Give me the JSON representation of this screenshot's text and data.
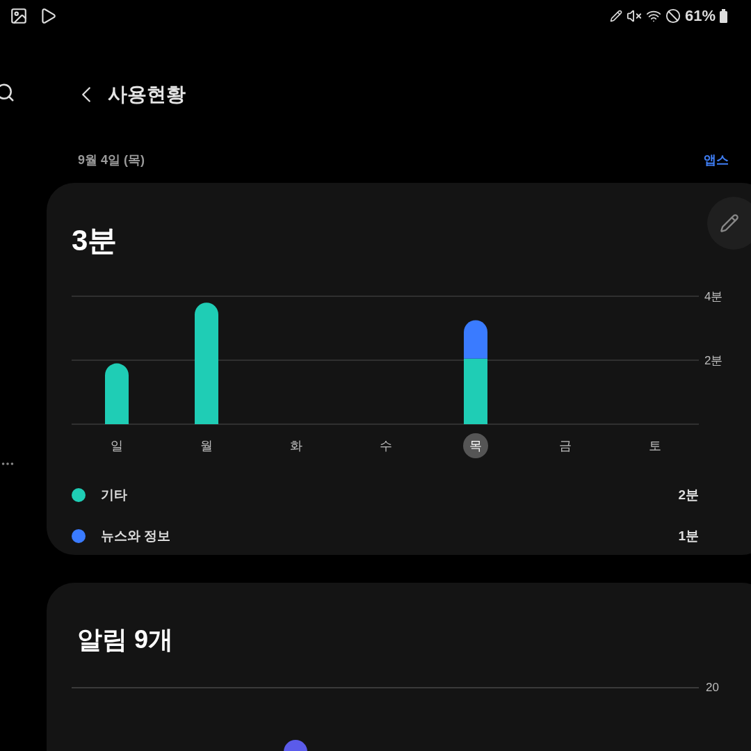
{
  "status_bar": {
    "battery": "61%"
  },
  "header": {
    "title": "사용현황",
    "date": "9월 4일 (목)",
    "link": "앱스"
  },
  "usage_card": {
    "total": "3분",
    "chart_data": {
      "type": "bar",
      "stacked": true,
      "categories": [
        "일",
        "월",
        "화",
        "수",
        "목",
        "금",
        "토"
      ],
      "series": [
        {
          "name": "기타",
          "color": "#1fcdb5",
          "values": [
            1.9,
            3.8,
            null,
            null,
            2.05,
            null,
            null
          ]
        },
        {
          "name": "뉴스와 정보",
          "color": "#3a7bff",
          "values": [
            null,
            null,
            null,
            null,
            1.2,
            null,
            null
          ]
        }
      ],
      "ylim": [
        0,
        4
      ],
      "yticks": [
        {
          "value": 2,
          "label": "2분"
        },
        {
          "value": 4,
          "label": "4분"
        }
      ]
    },
    "category_selected": [
      false,
      false,
      false,
      false,
      true,
      false,
      false
    ],
    "legend_values": [
      "2분",
      "1분"
    ]
  },
  "notifications_card": {
    "title": "알림 9개",
    "tick": "20"
  }
}
